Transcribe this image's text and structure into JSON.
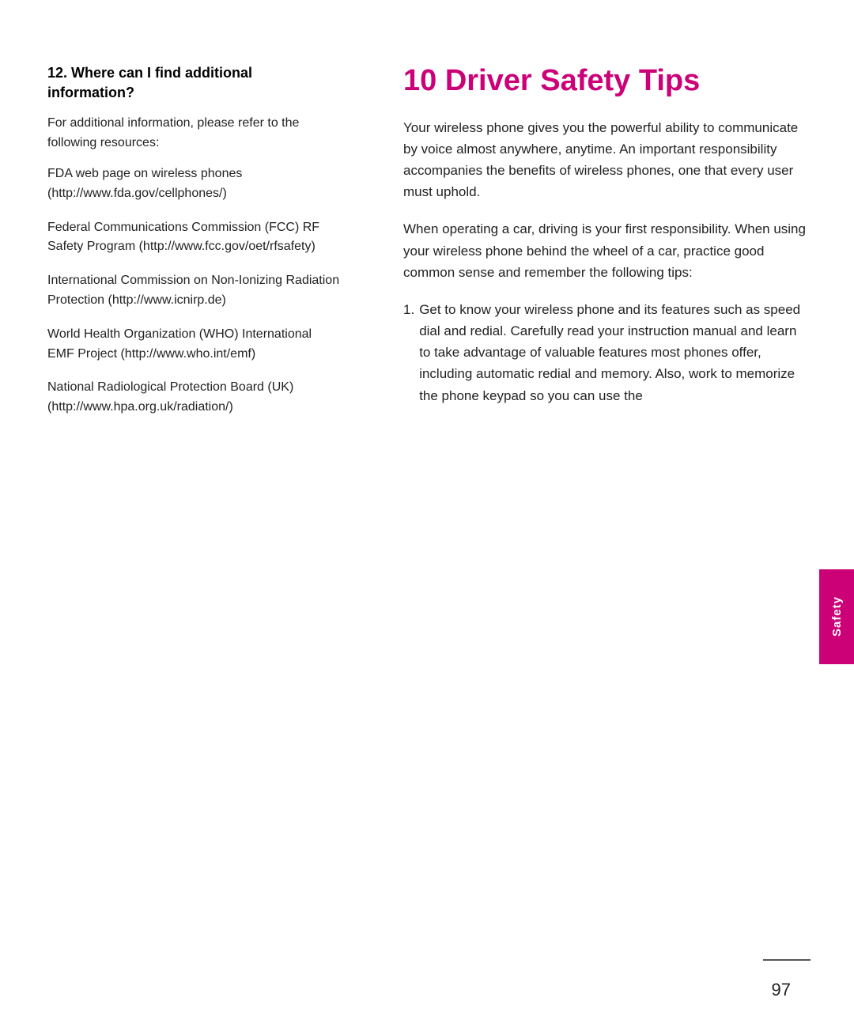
{
  "left_column": {
    "section_heading": "12. Where can I find additional information?",
    "intro_text": "For additional information, please refer to the following resources:",
    "resources": [
      {
        "text": "FDA web page on wireless phones (http://www.fda.gov/cellphones/)"
      },
      {
        "text": "Federal Communications Commission (FCC) RF Safety Program (http://www.fcc.gov/oet/rfsafety)"
      },
      {
        "text": "International Commission on Non-Ionizing Radiation Protection (http://www.icnirp.de)"
      },
      {
        "text": "World Health Organization (WHO) International EMF Project (http://www.who.int/emf)"
      },
      {
        "text": "National Radiological Protection Board (UK) (http://www.hpa.org.uk/radiation/)"
      }
    ]
  },
  "right_column": {
    "chapter_title": "10 Driver Safety Tips",
    "paragraphs": [
      "Your wireless phone gives you the powerful ability to communicate by voice almost anywhere, anytime. An important responsibility accompanies the benefits of wireless phones, one that every user must uphold.",
      "When operating a car, driving is your first responsibility. When using your wireless phone behind the wheel of a car, practice good common sense and remember the following tips:"
    ],
    "numbered_items": [
      "Get to know your wireless phone and its features such as speed dial and redial. Carefully read your instruction manual and learn to take advantage of valuable features most phones offer, including automatic redial and memory. Also, work to memorize the phone keypad so you can use the"
    ]
  },
  "sidebar": {
    "label": "Safety"
  },
  "footer": {
    "page_number": "97"
  }
}
